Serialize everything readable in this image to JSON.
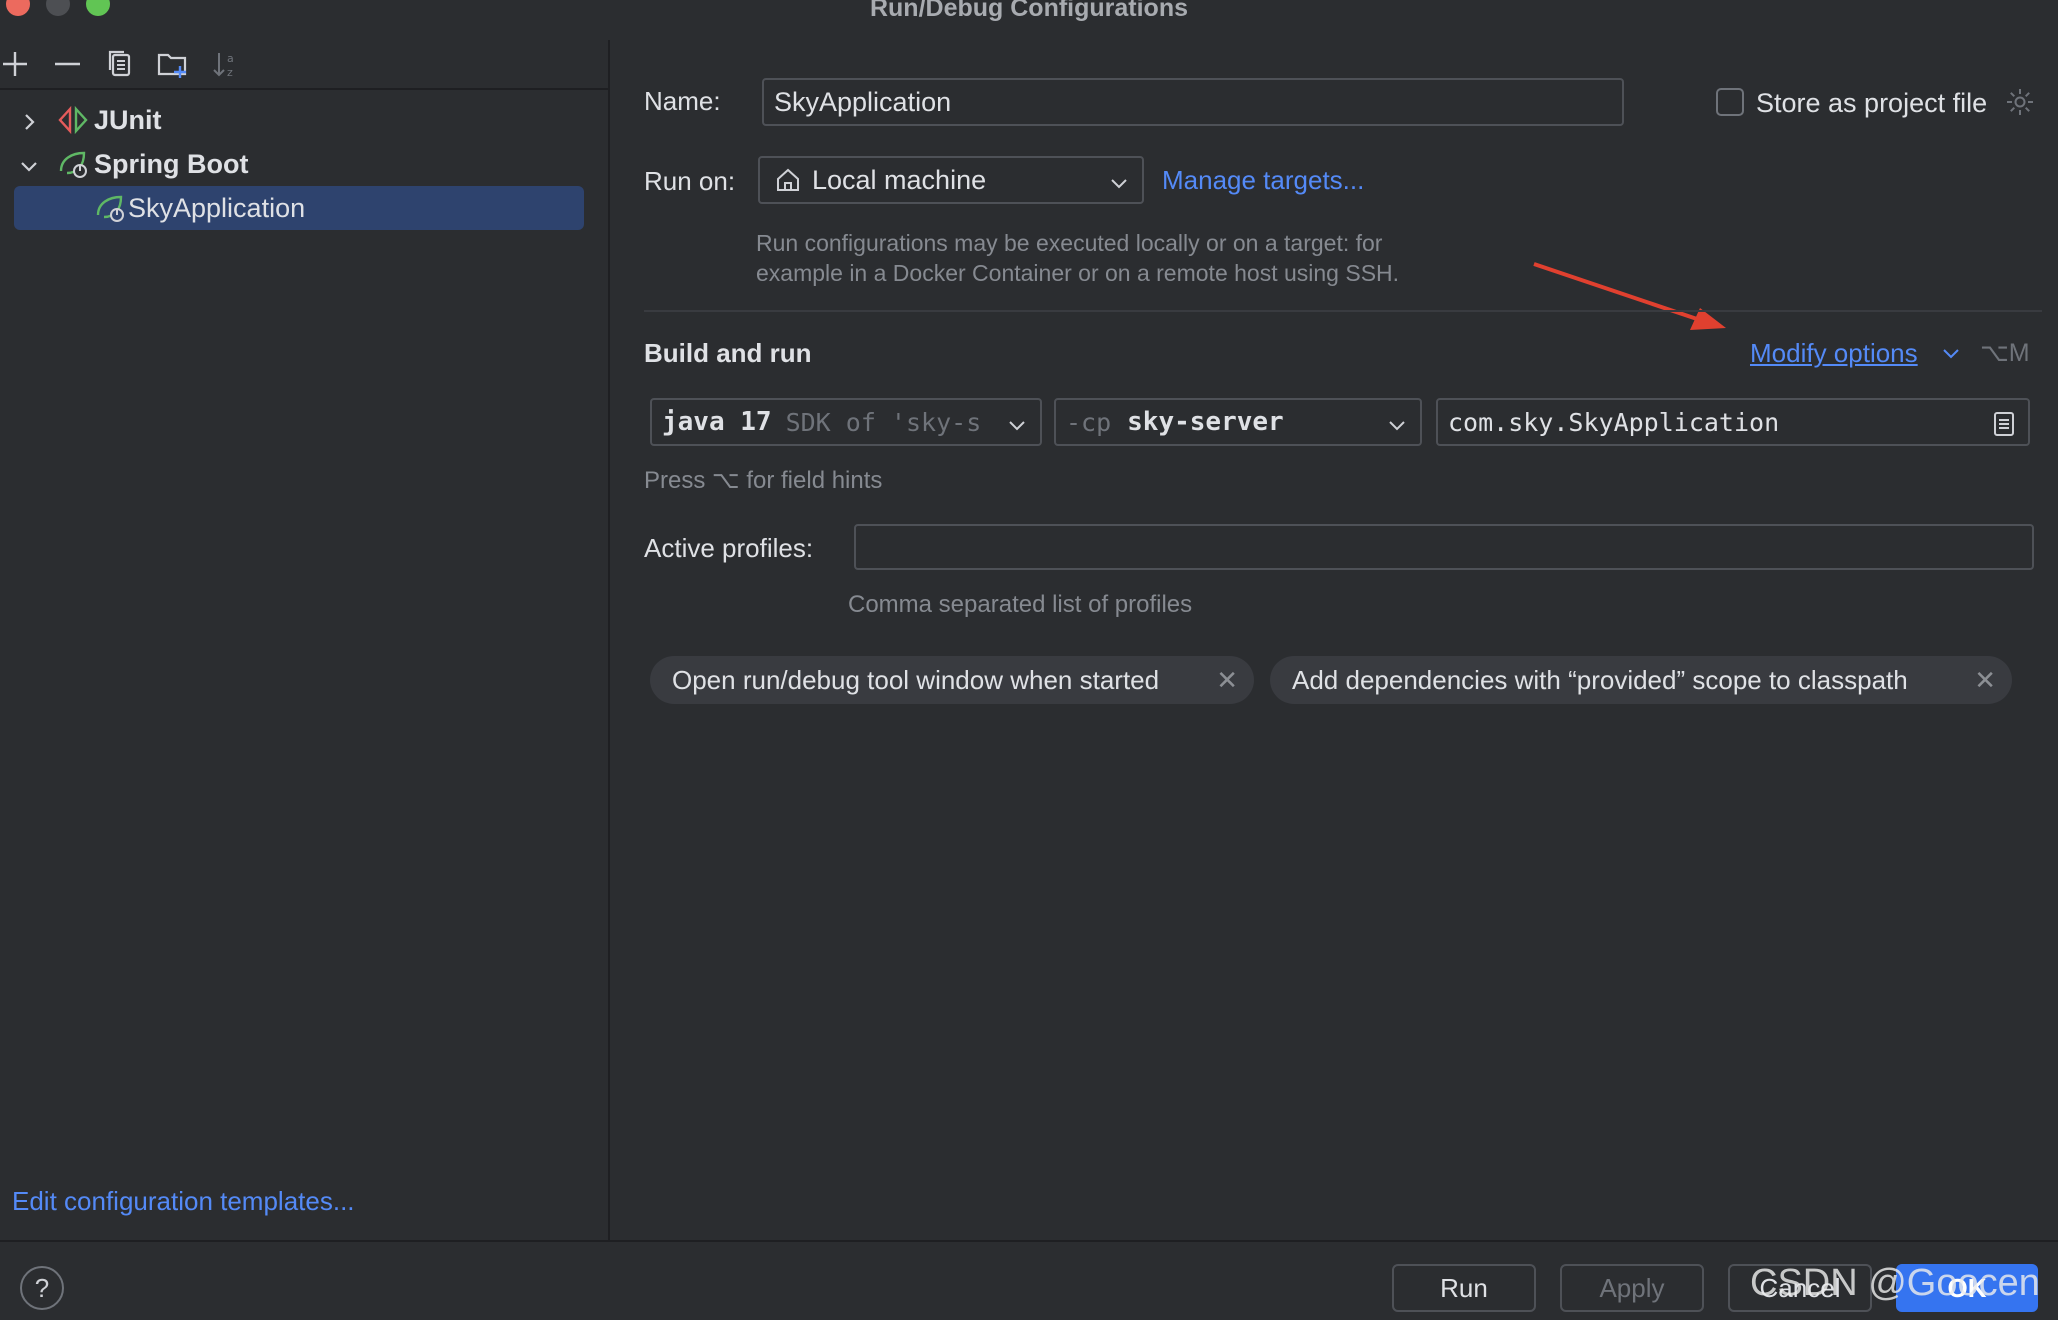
{
  "window": {
    "title": "Run/Debug Configurations"
  },
  "toolbar": {
    "icons": [
      "add-icon",
      "remove-icon",
      "copy-icon",
      "new-folder-icon",
      "sort-icon"
    ]
  },
  "tree": {
    "items": [
      {
        "label": "JUnit",
        "expanded": false,
        "icon": "junit-icon"
      },
      {
        "label": "Spring Boot",
        "expanded": true,
        "icon": "spring-boot-icon"
      },
      {
        "label": "SkyApplication",
        "icon": "spring-boot-run-icon",
        "selected": true
      }
    ],
    "edit_templates_link": "Edit configuration templates..."
  },
  "form": {
    "name_label": "Name:",
    "name_value": "SkyApplication",
    "store_label": "Store as project file",
    "store_checked": false,
    "run_on_label": "Run on:",
    "run_on_value": "Local machine",
    "manage_targets": "Manage targets...",
    "run_on_hint_1": "Run configurations may be executed locally or on a target: for",
    "run_on_hint_2": "example in a Docker Container or on a remote host using SSH.",
    "build_run_title": "Build and run",
    "modify_options": "Modify options",
    "modify_shortcut": "⌥M",
    "jdk_main": "java 17",
    "jdk_sub": "SDK of 'sky-s",
    "cp_prefix": "-cp",
    "cp_value": "sky-server",
    "main_class": "com.sky.SkyApplication",
    "field_hint": "Press ⌥ for field hints",
    "profiles_label": "Active profiles:",
    "profiles_value": "",
    "profiles_hint": "Comma separated list of profiles",
    "chips": [
      "Open run/debug tool window when started",
      "Add dependencies with “provided” scope to classpath"
    ]
  },
  "footer": {
    "help": "?",
    "run": "Run",
    "apply": "Apply",
    "cancel": "Cancel",
    "ok": "OK",
    "watermark": "CSDN @Goocen"
  },
  "colors": {
    "accent": "#548af7",
    "selection": "#2e436e",
    "ok_button": "#3574f0",
    "arrow": "#e0402f"
  }
}
